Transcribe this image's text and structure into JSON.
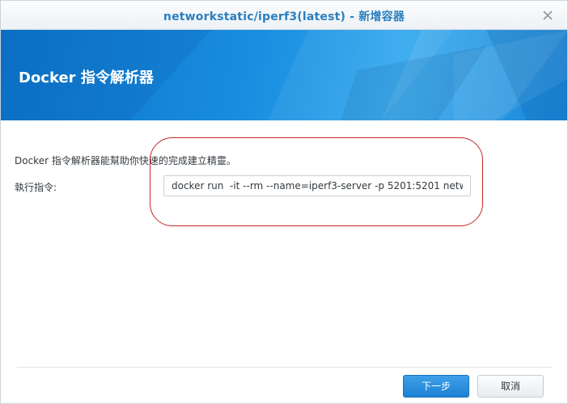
{
  "window": {
    "title": "networkstatic/iperf3(latest) - 新增容器"
  },
  "banner": {
    "title": "Docker 指令解析器"
  },
  "form": {
    "description": "Docker 指令解析器能幫助你快速的完成建立精靈。",
    "command_label": "執行指令:",
    "command_value": "docker run  -it --rm --name=iperf3-server -p 5201:5201 netw"
  },
  "buttons": {
    "next": "下一步",
    "cancel": "取消"
  },
  "colors": {
    "title_text": "#2a7fbf",
    "banner_blue": "#1a8ee0",
    "primary_button": "#1d82d4",
    "highlight_annotation": "#c62828"
  },
  "icons": {
    "close": "close-icon"
  }
}
